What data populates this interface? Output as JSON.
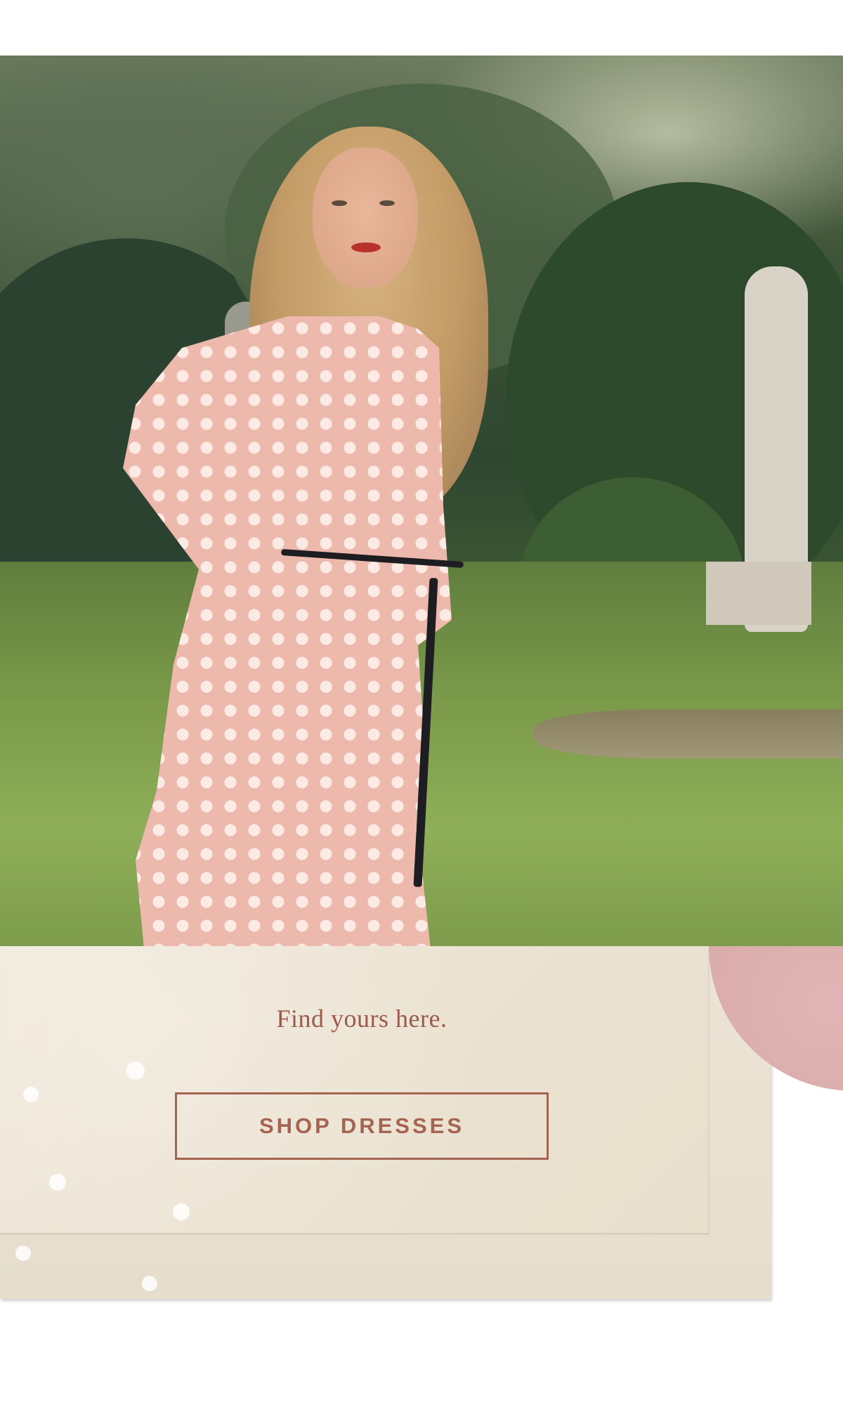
{
  "hero": {
    "image_alt": "Model in pink polka dot tiered dress with black ribbon belt standing in a garden"
  },
  "promo": {
    "tagline": "Find yours here.",
    "cta_label": "SHOP DRESSES"
  },
  "colors": {
    "accent": "#a56352",
    "tagline": "#9c5a4c",
    "paper": "#ede5d6",
    "pink_circle": "#d8a9a9"
  }
}
